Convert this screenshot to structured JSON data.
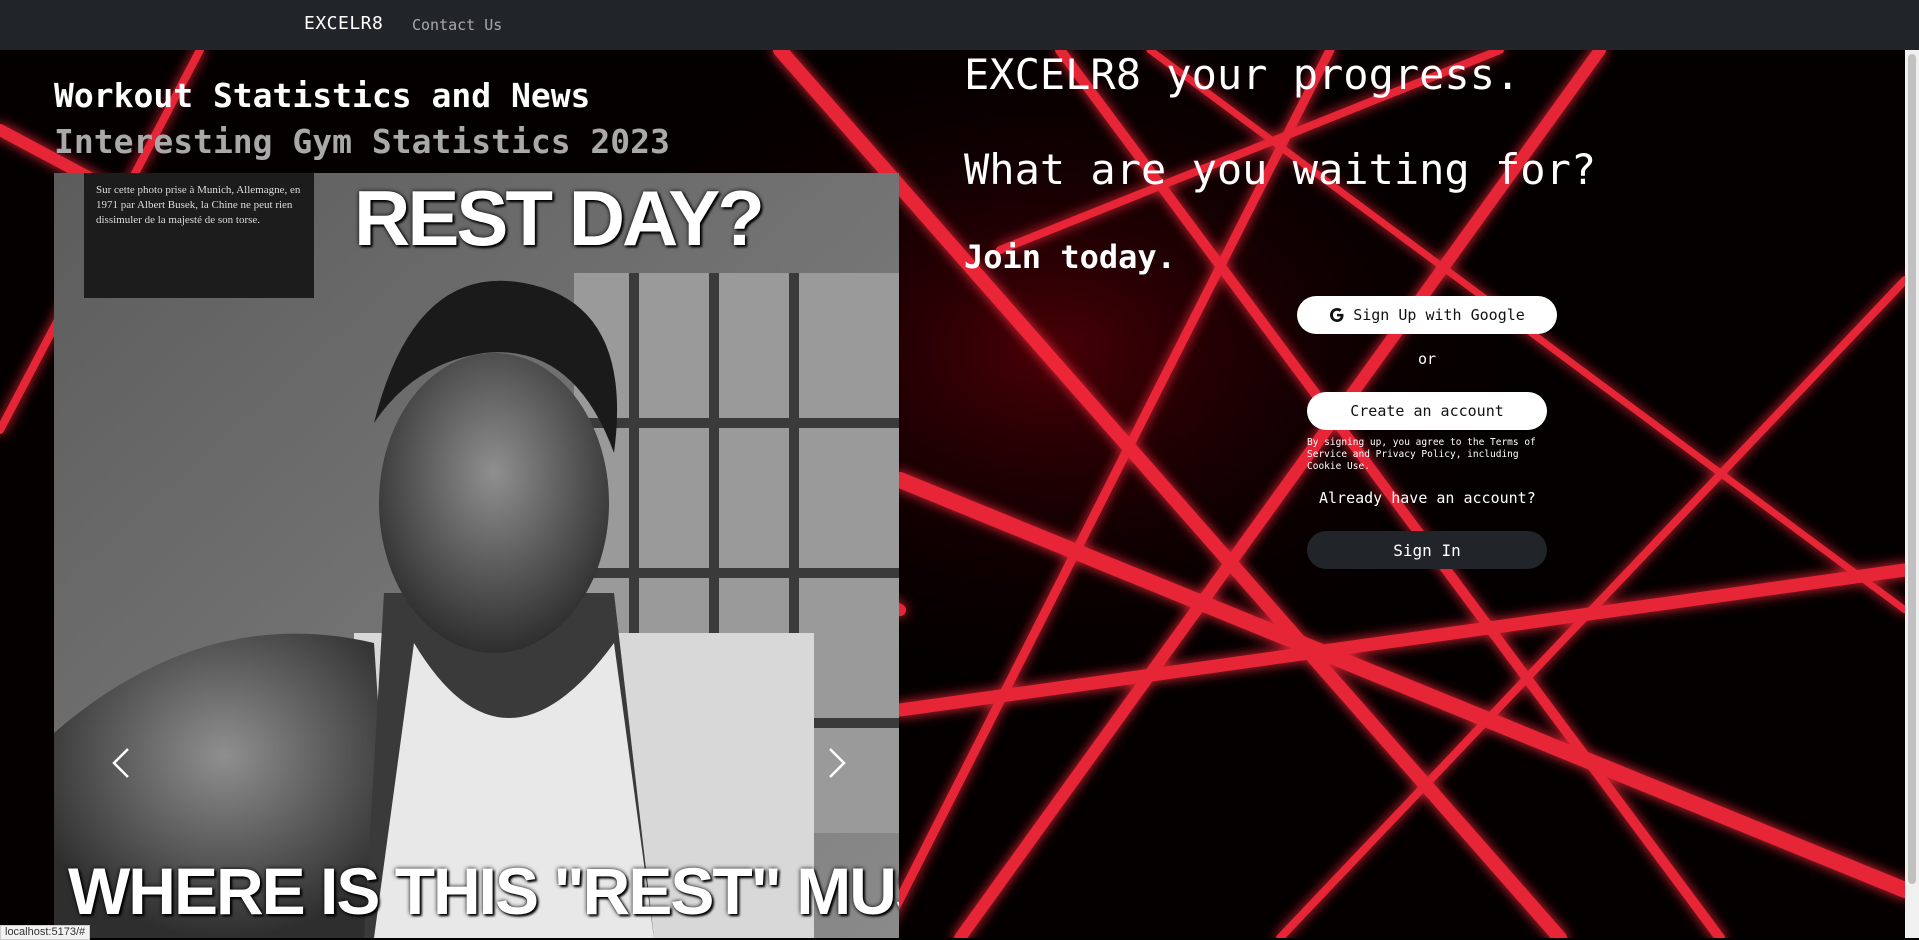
{
  "navbar": {
    "brand": "EXCELR8",
    "links": [
      "Contact Us"
    ]
  },
  "news": {
    "title": "Workout Statistics and News",
    "subtitle": "Interesting Gym Statistics 2023",
    "slide": {
      "top_text": "REST DAY?",
      "bottom_text": "WHERE IS THIS \"REST\" MUSCLE",
      "sign_text": "Sur cette photo prise à Munich, Allemagne, en 1971 par Albert Busek, la Chine ne peut rien dissimuler de la majesté de son torse."
    },
    "controls": {
      "prev": "prev-icon",
      "next": "next-icon"
    }
  },
  "hero": {
    "line1": "EXCELR8 your progress.",
    "line2": "What are you waiting for?",
    "line3": "Join today."
  },
  "auth": {
    "google_label": "Sign Up with Google",
    "google_icon": "google-icon",
    "or_label": "or",
    "create_label": "Create an account",
    "terms": "By signing up, you agree to the Terms of Service and Privacy Policy, including Cookie Use.",
    "already": "Already have an account?",
    "signin_label": "Sign In"
  },
  "status_bar": {
    "url": "localhost:5173/#"
  },
  "colors": {
    "navbar": "#212529",
    "laser": "#ff2a3c",
    "background": "#050000"
  }
}
